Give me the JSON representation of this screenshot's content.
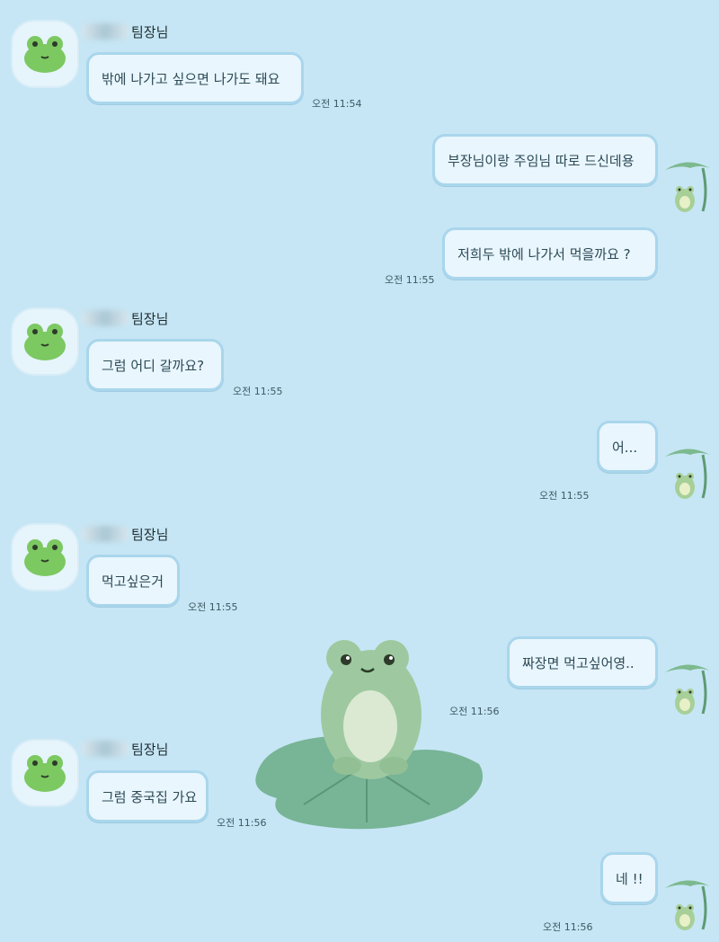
{
  "sender": {
    "name_suffix": "팀장님"
  },
  "messages": {
    "m1": {
      "text": "밖에 나가고 싶으면 나가도 돼요",
      "time": "오전 11:54"
    },
    "m2": {
      "text": "부장님이랑 주임님 따로 드신데용"
    },
    "m3": {
      "text": "저희두 밖에 나가서 먹을까요 ?",
      "time": "오전 11:55"
    },
    "m4": {
      "text": "그럼 어디 갈까요?",
      "time": "오전 11:55"
    },
    "m5": {
      "text": "어...",
      "time": "오전 11:55"
    },
    "m6": {
      "text": "먹고싶은거",
      "time": "오전 11:55"
    },
    "m7": {
      "text": "짜장면 먹고싶어영..",
      "time": "오전 11:56"
    },
    "m8": {
      "text": "그럼 중국집 가요",
      "time": "오전 11:56"
    },
    "m9": {
      "text": "네 !!",
      "time": "오전 11:56"
    }
  },
  "colors": {
    "background": "#c6e6f5",
    "bubble_fill": "#e9f6fd",
    "bubble_border": "#a9d6ec",
    "frog_green": "#7cc861",
    "sticker_frog": "#9ec9a0",
    "lilypad": "#6fae8c"
  },
  "icons": {
    "avatar": "green-frog-icon",
    "self_avatar": "frog-with-leaf-umbrella-icon",
    "sticker": "frog-on-lilypad-sticker"
  }
}
